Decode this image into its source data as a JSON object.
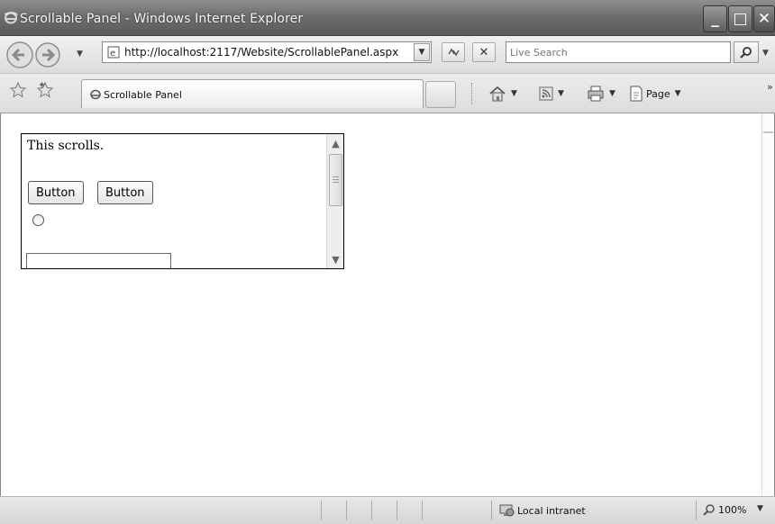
{
  "window": {
    "title": "Scrollable Panel - Windows Internet Explorer"
  },
  "toolbar": {
    "address_url": "http://localhost:2117/Website/ScrollablePanel.aspx",
    "search_placeholder": "Live Search"
  },
  "tabs": [
    {
      "label": "Scrollable Panel"
    }
  ],
  "command_bar": {
    "page_label": "Page"
  },
  "panel": {
    "text": "This scrolls.",
    "buttons": [
      "Button",
      "Button"
    ]
  },
  "status_bar": {
    "zone": "Local intranet",
    "zoom": "100%"
  },
  "icons": [
    "ie-logo-icon",
    "back-icon",
    "forward-icon",
    "page-icon",
    "refresh-icon",
    "stop-icon",
    "search-icon",
    "favorites-star-icon",
    "add-favorites-icon",
    "home-icon",
    "feeds-icon",
    "print-icon",
    "page-menu-icon",
    "globe-icon",
    "zoom-icon"
  ]
}
